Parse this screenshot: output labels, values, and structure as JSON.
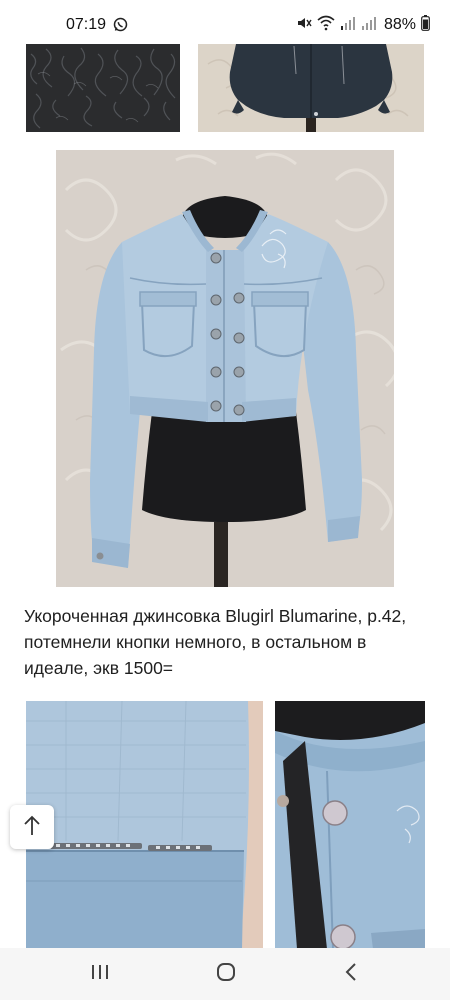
{
  "status_bar": {
    "time": "07:19",
    "battery_percent": "88%",
    "icons": [
      "whatsapp-icon",
      "mute-icon",
      "wifi-icon",
      "signal-icon",
      "signal-icon",
      "battery-icon"
    ]
  },
  "post": {
    "caption": "Укороченная джинсовка Blugirl Blumarine, р.42, потемнели кнопки немного, в остальном в идеале, экв 1500="
  },
  "navigation": {
    "icons": [
      "recent-apps-icon",
      "home-icon",
      "back-icon"
    ]
  },
  "colors": {
    "denim": "#a9c4dc",
    "background_wall": "#d9d2cb",
    "text": "#202020"
  }
}
